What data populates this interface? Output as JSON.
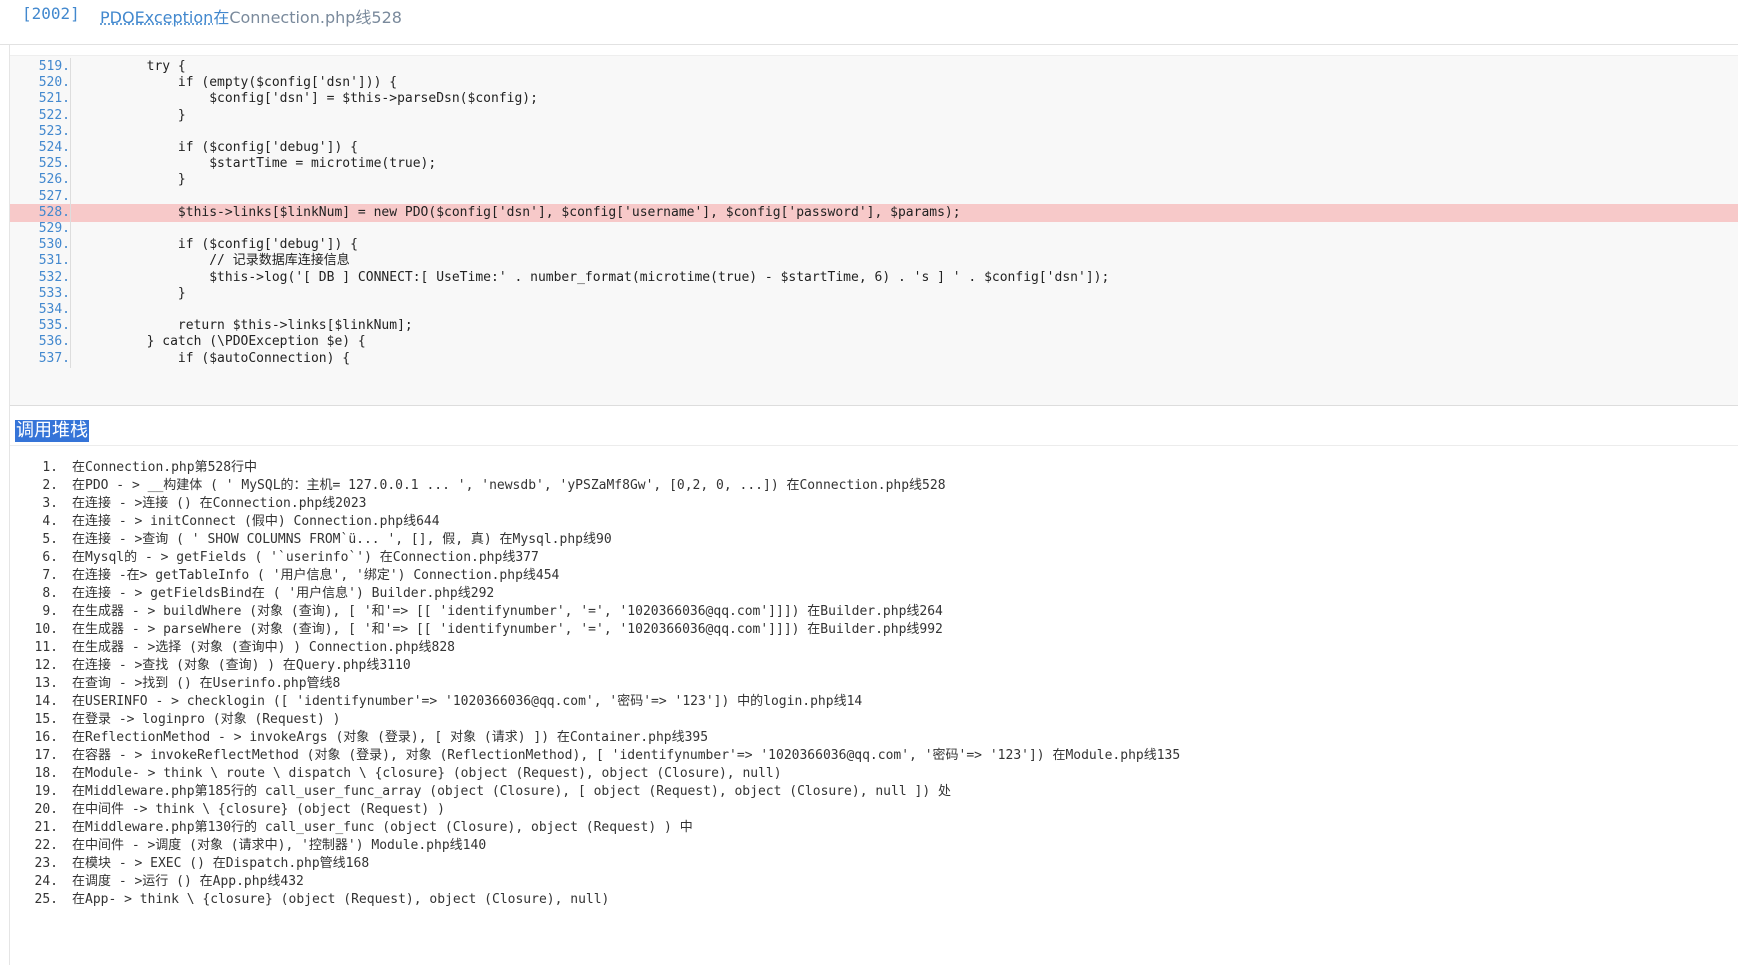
{
  "header": {
    "code": "[2002]",
    "exception": "PDOException",
    "at": "在",
    "file": "Connection.php线528"
  },
  "source": {
    "lines": [
      {
        "num": "519.",
        "text": "        try {",
        "hl": false
      },
      {
        "num": "520.",
        "text": "            if (empty($config['dsn'])) {",
        "hl": false
      },
      {
        "num": "521.",
        "text": "                $config['dsn'] = $this->parseDsn($config);",
        "hl": false
      },
      {
        "num": "522.",
        "text": "            }",
        "hl": false
      },
      {
        "num": "523.",
        "text": "",
        "hl": false
      },
      {
        "num": "524.",
        "text": "            if ($config['debug']) {",
        "hl": false
      },
      {
        "num": "525.",
        "text": "                $startTime = microtime(true);",
        "hl": false
      },
      {
        "num": "526.",
        "text": "            }",
        "hl": false
      },
      {
        "num": "527.",
        "text": "",
        "hl": false
      },
      {
        "num": "528.",
        "text": "            $this->links[$linkNum] = new PDO($config['dsn'], $config['username'], $config['password'], $params);",
        "hl": true
      },
      {
        "num": "529.",
        "text": "",
        "hl": false
      },
      {
        "num": "530.",
        "text": "            if ($config['debug']) {",
        "hl": false
      },
      {
        "num": "531.",
        "text": "                // 记录数据库连接信息",
        "hl": false
      },
      {
        "num": "532.",
        "text": "                $this->log('[ DB ] CONNECT:[ UseTime:' . number_format(microtime(true) - $startTime, 6) . 's ] ' . $config['dsn']);",
        "hl": false
      },
      {
        "num": "533.",
        "text": "            }",
        "hl": false
      },
      {
        "num": "534.",
        "text": "",
        "hl": false
      },
      {
        "num": "535.",
        "text": "            return $this->links[$linkNum];",
        "hl": false
      },
      {
        "num": "536.",
        "text": "        } catch (\\PDOException $e) {",
        "hl": false
      },
      {
        "num": "537.",
        "text": "            if ($autoConnection) {",
        "hl": false
      }
    ]
  },
  "stack": {
    "title": "调用堆栈",
    "items": [
      {
        "idx": "1.",
        "text": "在Connection.php第528行中"
      },
      {
        "idx": "2.",
        "text": "在PDO - > __构建体 ( ' MySQL的：主机= 127.0.0.1 ... ',  'newsdb',  'yPSZaMf8Gw', [0,2, 0, ...]) 在Connection.php线528"
      },
      {
        "idx": "3.",
        "text": "在连接 - >连接 () 在Connection.php线2023"
      },
      {
        "idx": "4.",
        "text": "在连接 - > initConnect (假中) Connection.php线644"
      },
      {
        "idx": "5.",
        "text": "在连接 - >查询 ( ' SHOW COLUMNS FROM`ü... ', [], 假, 真) 在Mysql.php线90"
      },
      {
        "idx": "6.",
        "text": "在Mysql的 - > getFields ( '`userinfo`') 在Connection.php线377"
      },
      {
        "idx": "7.",
        "text": "在连接 -在> getTableInfo ( '用户信息',  '绑定') Connection.php线454"
      },
      {
        "idx": "8.",
        "text": "在连接 - > getFieldsBind在 ( '用户信息') Builder.php线292"
      },
      {
        "idx": "9.",
        "text": "在生成器 - > buildWhere (对象 (查询), [ '和'=> [[ 'identifynumber',  '=',  '1020366036@qq.com']]]) 在Builder.php线264"
      },
      {
        "idx": "10.",
        "text": "在生成器 - > parseWhere (对象 (查询), [ '和'=> [[ 'identifynumber',  '=',  '1020366036@qq.com']]]) 在Builder.php线992"
      },
      {
        "idx": "11.",
        "text": "在生成器 - >选择 (对象 (查询中) ) Connection.php线828"
      },
      {
        "idx": "12.",
        "text": "在连接 - >查找 (对象 (查询) ) 在Query.php线3110"
      },
      {
        "idx": "13.",
        "text": "在查询 - >找到 () 在Userinfo.php管线8"
      },
      {
        "idx": "14.",
        "text": "在USERINFO - > checklogin ([ 'identifynumber'=> '1020366036@qq.com',  '密码'=> '123']) 中的login.php线14"
      },
      {
        "idx": "15.",
        "text": "在登录 -> loginpro (对象 (Request) )"
      },
      {
        "idx": "16.",
        "text": "在ReflectionMethod - > invokeArgs (对象 (登录), [ 对象 (请求) ]) 在Container.php线395"
      },
      {
        "idx": "17.",
        "text": "在容器 - > invokeReflectMethod (对象 (登录), 对象 (ReflectionMethod), [ 'identifynumber'=> '1020366036@qq.com',  '密码'=> '123']) 在Module.php线135"
      },
      {
        "idx": "18.",
        "text": "在Module- > think \\ route \\ dispatch \\ {closure} (object (Request), object (Closure), null)"
      },
      {
        "idx": "19.",
        "text": "在Middleware.php第185行的 call_user_func_array (object (Closure), [ object (Request), object (Closure), null ]) 处"
      },
      {
        "idx": "20.",
        "text": "在中间件 -> think \\ {closure} (object (Request) )"
      },
      {
        "idx": "21.",
        "text": "在Middleware.php第130行的 call_user_func (object (Closure), object (Request) ) 中"
      },
      {
        "idx": "22.",
        "text": "在中间件 - >调度 (对象 (请求中),  '控制器') Module.php线140"
      },
      {
        "idx": "23.",
        "text": "在模块 - > EXEC () 在Dispatch.php管线168"
      },
      {
        "idx": "24.",
        "text": "在调度 - >运行 () 在App.php线432"
      },
      {
        "idx": "25.",
        "text": "在App- > think \\ {closure} (object (Request), object (Closure), null)"
      }
    ]
  }
}
